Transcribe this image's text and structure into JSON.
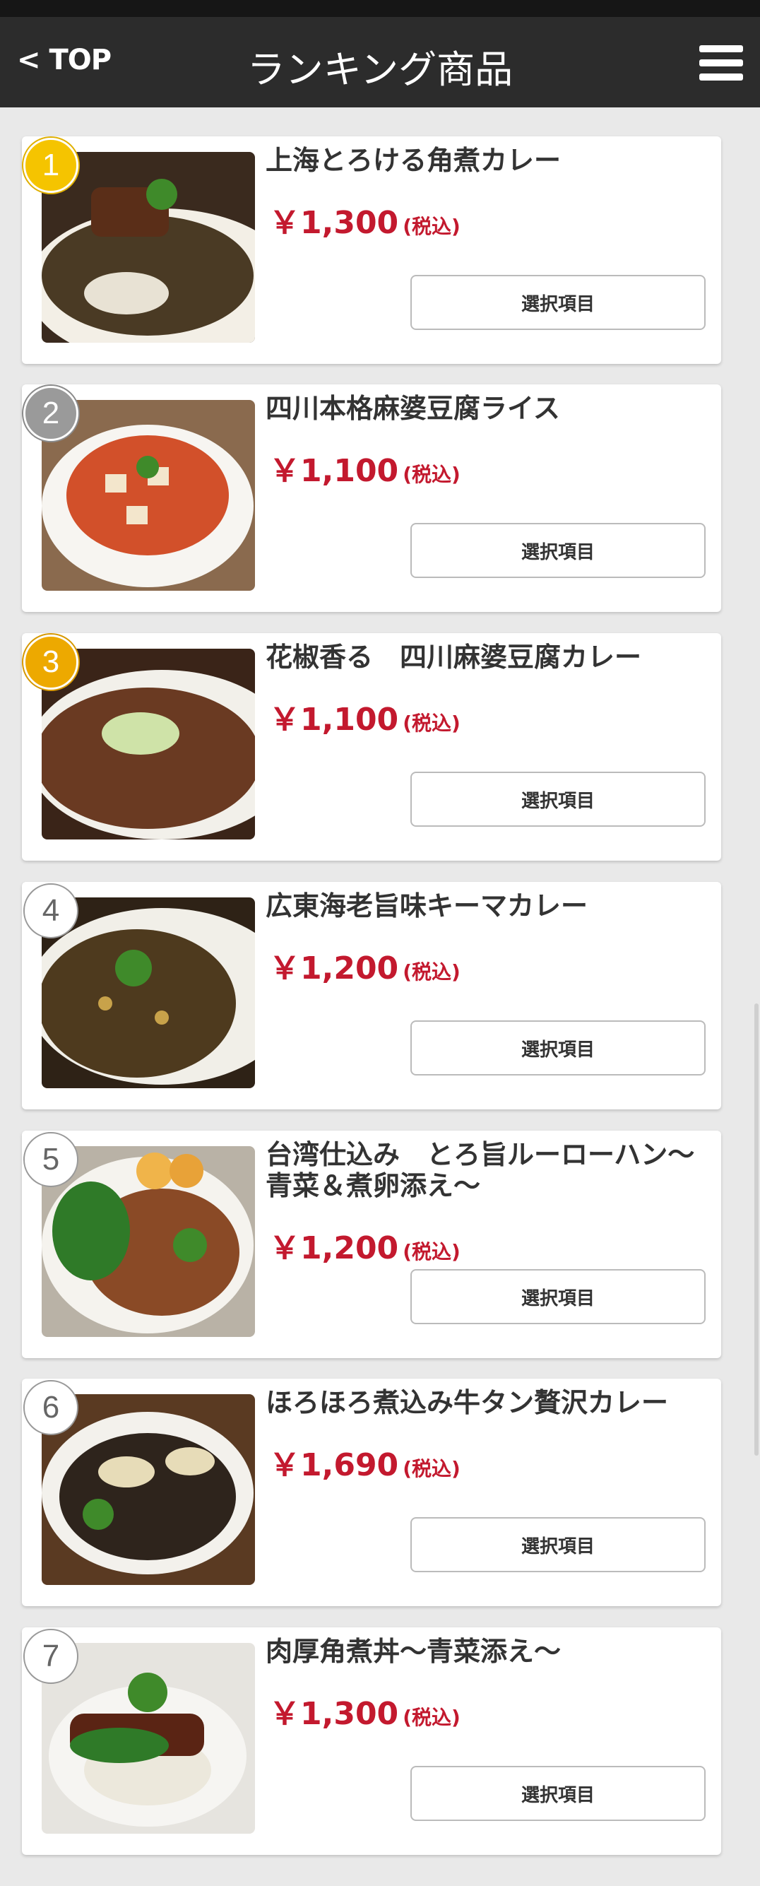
{
  "header": {
    "back_label": "< TOP",
    "title": "ランキング商品"
  },
  "items": [
    {
      "rank": "1",
      "name": "上海とろける角煮カレー",
      "price": "￥1,300",
      "tax": "(税込)",
      "button": "選択項目"
    },
    {
      "rank": "2",
      "name": "四川本格麻婆豆腐ライス",
      "price": "￥1,100",
      "tax": "(税込)",
      "button": "選択項目"
    },
    {
      "rank": "3",
      "name": "花椒香る　四川麻婆豆腐カレー",
      "price": "￥1,100",
      "tax": "(税込)",
      "button": "選択項目"
    },
    {
      "rank": "4",
      "name": "広東海老旨味キーマカレー",
      "price": "￥1,200",
      "tax": "(税込)",
      "button": "選択項目"
    },
    {
      "rank": "5",
      "name": "台湾仕込み　とろ旨ルーローハン〜青菜＆煮卵添え〜",
      "price": "￥1,200",
      "tax": "(税込)",
      "button": "選択項目"
    },
    {
      "rank": "6",
      "name": "ほろほろ煮込み牛タン贅沢カレー",
      "price": "￥1,690",
      "tax": "(税込)",
      "button": "選択項目"
    },
    {
      "rank": "7",
      "name": "肉厚角煮丼〜青菜添え〜",
      "price": "￥1,300",
      "tax": "(税込)",
      "button": "選択項目"
    }
  ],
  "colors": {
    "header_bg": "#2c2c2c",
    "price": "#c3192e",
    "rank_gold": "#f5c400",
    "rank_silver": "#9a9a9a",
    "rank_bronze": "#eda900"
  },
  "icons": {
    "menu": "hamburger-menu-icon"
  }
}
